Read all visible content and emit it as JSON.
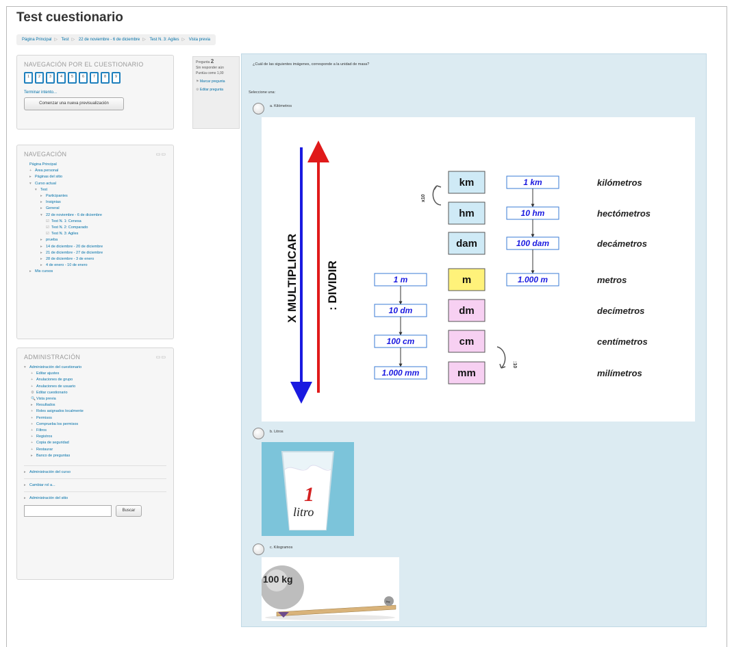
{
  "page": {
    "title": "Test cuestionario"
  },
  "breadcrumb": [
    "Página Principal",
    "Test",
    "22 de noviembre - 6 de diciembre",
    "Test N. 3: Agiles",
    "Vista previa"
  ],
  "quiz_nav": {
    "title": "NAVEGACIÓN POR EL CUESTIONARIO",
    "questions": [
      "1",
      "2",
      "3",
      "4",
      "5",
      "6",
      "7",
      "8",
      "9"
    ],
    "finish_link": "Terminar intento...",
    "preview_button": "Comenzar una nueva previsualización"
  },
  "navigation": {
    "title": "NAVEGACIÓN",
    "items": [
      {
        "label": "Página Principal",
        "mark": ""
      },
      {
        "label": "Área personal",
        "mark": "+"
      },
      {
        "label": "Páginas del sitio",
        "mark": "▸"
      },
      {
        "label": "Curso actual",
        "mark": "▾"
      },
      {
        "label": "Test",
        "mark": "▾"
      },
      {
        "label": "Participantes",
        "mark": "▸"
      },
      {
        "label": "Insignias",
        "mark": "▸"
      },
      {
        "label": "General",
        "mark": "▸"
      },
      {
        "label": "22 de noviembre - 6 de diciembre",
        "mark": "▾"
      },
      {
        "label": "Test N. 1: Cenesa",
        "mark": "☑"
      },
      {
        "label": "Test N. 2: Comparado",
        "mark": "☑"
      },
      {
        "label": "Test N. 3: Agiles",
        "mark": "☑"
      },
      {
        "label": "prueba",
        "mark": "▸"
      },
      {
        "label": "14 de diciembre - 20 de diciembre",
        "mark": "▸"
      },
      {
        "label": "21 de diciembre - 27 de diciembre",
        "mark": "▸"
      },
      {
        "label": "28 de diciembre - 3 de enero",
        "mark": "▸"
      },
      {
        "label": "4 de enero - 10 de enero",
        "mark": "▸"
      },
      {
        "label": "Mis cursos",
        "mark": "▸"
      }
    ]
  },
  "admin": {
    "title": "ADMINISTRACIÓN",
    "items": [
      {
        "label": "Administración del cuestionario",
        "mark": "▾"
      },
      {
        "label": "Editar ajustes",
        "mark": "+"
      },
      {
        "label": "Anulaciones de grupo",
        "mark": "+"
      },
      {
        "label": "Anulaciones de usuario",
        "mark": "+"
      },
      {
        "label": "Editar cuestionario",
        "mark": "⚙"
      },
      {
        "label": "Vista previa",
        "mark": "🔍"
      },
      {
        "label": "Resultados",
        "mark": "▸"
      },
      {
        "label": "Roles asignados localmente",
        "mark": "+"
      },
      {
        "label": "Permisos",
        "mark": "+"
      },
      {
        "label": "Comprueba los permisos",
        "mark": "+"
      },
      {
        "label": "Filtros",
        "mark": "+"
      },
      {
        "label": "Registros",
        "mark": "+"
      },
      {
        "label": "Copia de seguridad",
        "mark": "+"
      },
      {
        "label": "Restaurar",
        "mark": "+"
      },
      {
        "label": "Banco de preguntas",
        "mark": "▸"
      }
    ],
    "extra": [
      {
        "label": "Administración del curso",
        "mark": "▸"
      },
      {
        "label": "Cambiar rol a...",
        "mark": "▸"
      },
      {
        "label": "Administración del sitio",
        "mark": "▸"
      }
    ],
    "search_button": "Buscar"
  },
  "question_info": {
    "label": "Pregunta",
    "number": "2",
    "status": "Sin responder aún",
    "points": "Puntúa como 1,00",
    "flag": "Marcar pregunta",
    "edit": "Editar pregunta"
  },
  "question": {
    "text": "¿Cuál de las siguientes imágenes, corresponde a la unidad de masa?",
    "select_one": "Seleccione una:",
    "options": [
      "a. Kilómetros",
      "b. Litros",
      "c. Kilogramos"
    ]
  },
  "metric_chart": {
    "multiply_label": "X  MULTIPLICAR",
    "divide_label": ":  DIVIDIR",
    "x10_up": "x10",
    "div10_down": ":10",
    "units": [
      {
        "code": "km",
        "name": "kilómetros",
        "upper": "1 km",
        "lower": "",
        "color": "#cfeaf6"
      },
      {
        "code": "hm",
        "name": "hectómetros",
        "upper": "10 hm",
        "lower": "",
        "color": "#cfeaf6"
      },
      {
        "code": "dam",
        "name": "decámetros",
        "upper": "100 dam",
        "lower": "",
        "color": "#cfeaf6"
      },
      {
        "code": "m",
        "name": "metros",
        "upper": "1.000 m",
        "lower": "1 m",
        "color": "#fff27a"
      },
      {
        "code": "dm",
        "name": "decímetros",
        "upper": "",
        "lower": "10 dm",
        "color": "#f7d0f2"
      },
      {
        "code": "cm",
        "name": "centímetros",
        "upper": "",
        "lower": "100 cm",
        "color": "#f7d0f2"
      },
      {
        "code": "mm",
        "name": "milímetros",
        "upper": "",
        "lower": "1.000 mm",
        "color": "#f7d0f2"
      }
    ]
  },
  "liter_image": {
    "number": "1",
    "word": "litro"
  },
  "weight_image": {
    "label": "100 kg",
    "small": "1kg"
  }
}
